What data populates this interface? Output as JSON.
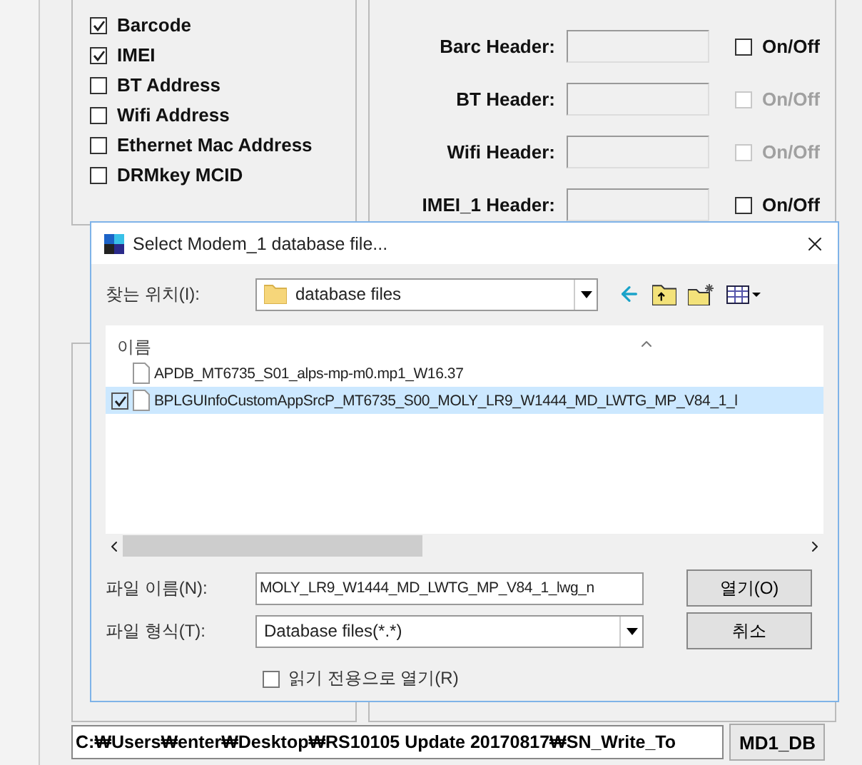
{
  "options": [
    {
      "label": "Barcode",
      "checked": true
    },
    {
      "label": "IMEI",
      "checked": true
    },
    {
      "label": "BT Address",
      "checked": false
    },
    {
      "label": "Wifi Address",
      "checked": false
    },
    {
      "label": "Ethernet Mac Address",
      "checked": false
    },
    {
      "label": "DRMkey MCID",
      "checked": false
    }
  ],
  "headers": [
    {
      "label": "Barc Header:",
      "toggle": {
        "label": "On/Off",
        "checked": false,
        "disabled": false
      }
    },
    {
      "label": "BT Header:",
      "toggle": {
        "label": "On/Off",
        "checked": false,
        "disabled": true
      }
    },
    {
      "label": "Wifi Header:",
      "toggle": {
        "label": "On/Off",
        "checked": false,
        "disabled": true
      }
    },
    {
      "label": "IMEI_1 Header:",
      "toggle": {
        "label": "On/Off",
        "checked": false,
        "disabled": false
      }
    }
  ],
  "path_field": {
    "value": "C:₩Users₩enter₩Desktop₩RS10105 Update 20170817₩SN_Write_To"
  },
  "md1_button": "MD1_DB",
  "dialog": {
    "title": "Select Modem_1 database file...",
    "look_in": {
      "label": "찾는 위치(I):",
      "value": "database files"
    },
    "list": {
      "column": "이름",
      "items": [
        {
          "name": "APDB_MT6735_S01_alps-mp-m0.mp1_W16.37",
          "selected": false,
          "checked": false
        },
        {
          "name": "BPLGUInfoCustomAppSrcP_MT6735_S00_MOLY_LR9_W1444_MD_LWTG_MP_V84_1_l",
          "selected": true,
          "checked": true
        }
      ]
    },
    "file_name": {
      "label": "파일 이름(N):",
      "value": "MOLY_LR9_W1444_MD_LWTG_MP_V84_1_lwg_n"
    },
    "file_type": {
      "label": "파일 형식(T):",
      "value": "Database files(*.*)"
    },
    "open_button": "열기(O)",
    "cancel_button": "취소",
    "read_only": {
      "label": "읽기 전용으로 열기(R)",
      "checked": false
    }
  }
}
